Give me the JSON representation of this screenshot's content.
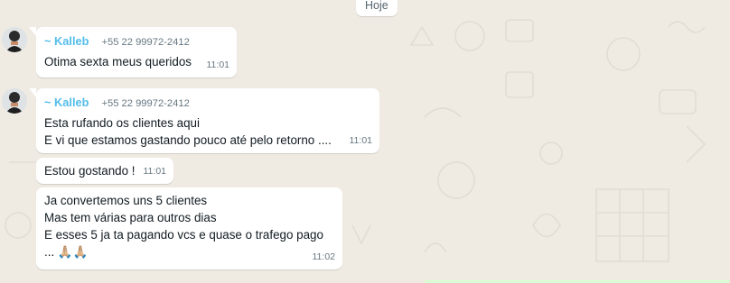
{
  "chat": {
    "date_chip": "Hoje",
    "messages": [
      {
        "sender": "~ Kalleb",
        "phone": "+55 22 99972-2412",
        "lines": [
          "Otima sexta meus queridos"
        ],
        "time": "11:01"
      },
      {
        "sender": "~ Kalleb",
        "phone": "+55 22 99972-2412",
        "lines": [
          "Esta rufando os clientes aqui",
          "E vi que estamos gastando pouco até pelo retorno ...."
        ],
        "time": "11:01"
      },
      {
        "lines": [
          "Estou gostando !"
        ],
        "time": "11:01"
      },
      {
        "lines": [
          "Ja convertemos uns 5 clientes",
          "Mas tem várias para outros dias",
          "E esses 5 ja ta pagando vcs e quase o trafego pago",
          "... 🙏🏼🙏🏼"
        ],
        "time": "11:02"
      }
    ]
  },
  "colors": {
    "background": "#efeae2",
    "bubble": "#ffffff",
    "sender_name": "#53bdeb",
    "meta": "#667781"
  }
}
